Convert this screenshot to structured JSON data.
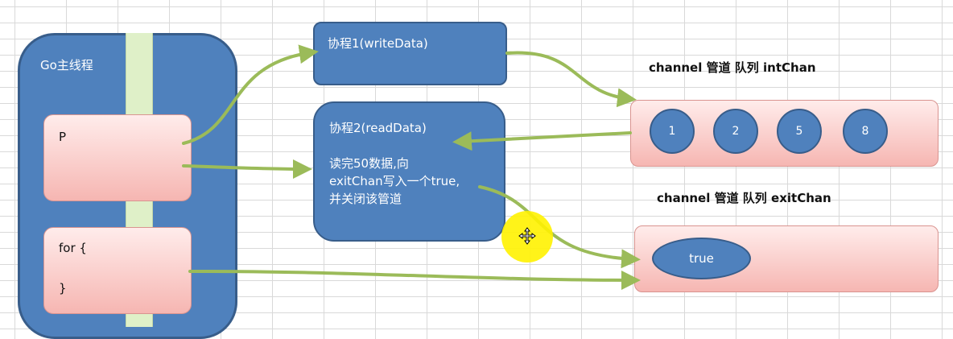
{
  "main": {
    "title": "Go主线程"
  },
  "p_box": {
    "label": "P"
  },
  "for_box": {
    "line1": "for {",
    "line2": "}"
  },
  "write_goroutine": {
    "title": "协程1(writeData)"
  },
  "read_goroutine": {
    "title": "协程2(readData)",
    "desc_lines": [
      "读完50数据,向",
      "exitChan写入一个true,",
      "并关闭该管道"
    ]
  },
  "int_chan": {
    "label": "channel 管道 队列 intChan",
    "items": [
      "1",
      "2",
      "5",
      "8"
    ]
  },
  "exit_chan": {
    "label": "channel 管道 队列 exitChan",
    "items": [
      "true"
    ]
  },
  "colors": {
    "arrow": "#9bbb59",
    "box_blue": "#4f81bd",
    "queue_pink": "#f6b6b2"
  },
  "icons": {
    "cursor": "move-cursor-icon"
  }
}
